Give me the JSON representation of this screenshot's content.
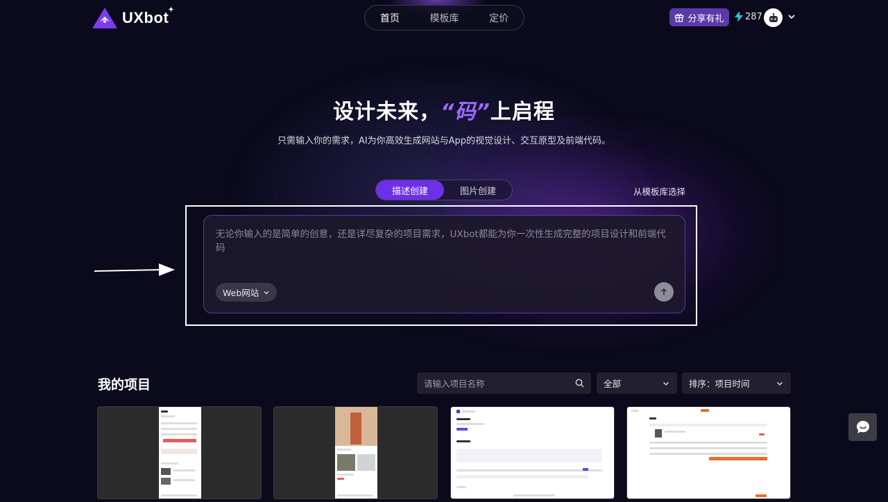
{
  "header": {
    "logo_text": "UXbot",
    "nav": [
      {
        "label": "首页",
        "active": true
      },
      {
        "label": "模板库",
        "active": false
      },
      {
        "label": "定价",
        "active": false
      }
    ],
    "gift_label": "分享有礼",
    "credits": "287"
  },
  "hero": {
    "title_before": "设计未来，",
    "title_highlight": "“码”",
    "title_after": "上启程",
    "subtitle": "只需输入你的需求，AI为你高效生成网站与App的视觉设计、交互原型及前端代码。"
  },
  "create": {
    "tabs": [
      {
        "label": "描述创建",
        "active": true
      },
      {
        "label": "图片创建",
        "active": false
      }
    ],
    "template_link": "从模板库选择",
    "placeholder": "无论你输入的是简单的创意，还是详尽复杂的项目需求，UXbot都能为你一次性生成完整的项目设计和前端代码",
    "type_select": "Web网站"
  },
  "projects": {
    "title": "我的项目",
    "search_placeholder": "请输入项目名称",
    "filter_value": "全部",
    "sort_label": "排序：",
    "sort_value": "项目时间"
  },
  "colors": {
    "accent": "#6d2fe8",
    "highlight_text": "#9a6bff",
    "background": "#0b0a1c"
  }
}
